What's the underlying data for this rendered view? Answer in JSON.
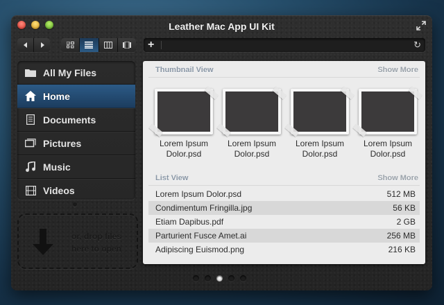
{
  "window": {
    "title": "Leather Mac App UI Kit"
  },
  "icons": {
    "close": "red-circle",
    "minimize": "yellow-circle",
    "zoom": "green-circle",
    "fullscreen": "expand-arrows",
    "back": "left-triangle",
    "forward": "right-triangle",
    "add": "plus",
    "refresh": "refresh-arrow",
    "drop": "down-arrow"
  },
  "toolbar": {
    "add_label": "+",
    "refresh_label": "↻",
    "path_value": ""
  },
  "sidebar": {
    "items": [
      {
        "label": "All My Files",
        "icon": "folder-icon",
        "active": false
      },
      {
        "label": "Home",
        "icon": "home-icon",
        "active": true
      },
      {
        "label": "Documents",
        "icon": "document-icon",
        "active": false
      },
      {
        "label": "Pictures",
        "icon": "pictures-icon",
        "active": false
      },
      {
        "label": "Music",
        "icon": "music-note-icon",
        "active": false
      },
      {
        "label": "Videos",
        "icon": "film-icon",
        "active": false
      }
    ]
  },
  "dropzone": {
    "line1": "or, drop files",
    "line2": "here to open"
  },
  "thumbnail_view": {
    "title": "Thumbnail View",
    "show_more": "Show More",
    "items": [
      {
        "line1": "Lorem Ipsum",
        "line2": "Dolor.psd"
      },
      {
        "line1": "Lorem Ipsum",
        "line2": "Dolor.psd"
      },
      {
        "line1": "Lorem Ipsum",
        "line2": "Dolor.psd"
      },
      {
        "line1": "Lorem Ipsum",
        "line2": "Dolor.psd"
      }
    ]
  },
  "list_view": {
    "title": "List View",
    "show_more": "Show More",
    "rows": [
      {
        "name": "Lorem Ipsum Dolor.psd",
        "size": "512 MB"
      },
      {
        "name": "Condimentum Fringilla.jpg",
        "size": "56 KB"
      },
      {
        "name": "Etiam Dapibus.pdf",
        "size": "2 GB"
      },
      {
        "name": "Parturient Fusce Amet.ai",
        "size": "256 MB"
      },
      {
        "name": "Adipiscing Euismod.png",
        "size": "216 KB"
      }
    ]
  },
  "pagination": {
    "count": 5,
    "active_index": 2
  },
  "colors": {
    "accent": "#2c5a86",
    "panel": "#ececec",
    "leather": "#2a2a2a"
  }
}
